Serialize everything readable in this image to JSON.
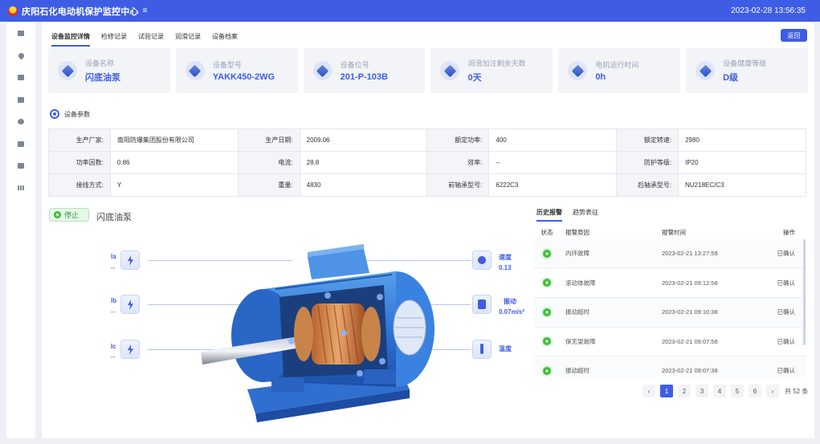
{
  "app": {
    "title": "庆阳石化电动机保护监控中心",
    "datetime": "2023-02-28 13:56:35"
  },
  "tabs": [
    "设备监控详情",
    "检修记录",
    "试验记录",
    "润滑记录",
    "设备档案"
  ],
  "back_label": "返回",
  "cards": [
    {
      "label": "设备名称",
      "value": "闪底油泵"
    },
    {
      "label": "设备型号",
      "value": "YAKK450-2WG"
    },
    {
      "label": "设备位号",
      "value": "201-P-103B"
    },
    {
      "label": "润滑加注剩余天数",
      "value": "0天"
    },
    {
      "label": "电机运行时间",
      "value": "0h"
    },
    {
      "label": "设备健康等级",
      "value": "D级"
    }
  ],
  "params_title": "设备参数",
  "params": [
    [
      {
        "k": "生产厂家:",
        "v": "南阳防爆集团股份有限公司"
      },
      {
        "k": "生产日期:",
        "v": "2009.06"
      },
      {
        "k": "额定功率:",
        "v": "400"
      },
      {
        "k": "额定转速:",
        "v": "2980"
      }
    ],
    [
      {
        "k": "功率因数:",
        "v": "0.86"
      },
      {
        "k": "电流:",
        "v": "28.8"
      },
      {
        "k": "效率:",
        "v": "--"
      },
      {
        "k": "防护等级:",
        "v": "IP20"
      }
    ],
    [
      {
        "k": "接线方式:",
        "v": "Y"
      },
      {
        "k": "重量:",
        "v": "4830"
      },
      {
        "k": "前轴承型号:",
        "v": "6222C3"
      },
      {
        "k": "后轴承型号:",
        "v": "NU218EC/C3"
      }
    ]
  ],
  "status": {
    "label": "停止",
    "equipment": "闪底油泵"
  },
  "sensors_left": [
    {
      "label": "Ia",
      "value": "--"
    },
    {
      "label": "Ib",
      "value": "--"
    },
    {
      "label": "Ic",
      "value": "--"
    }
  ],
  "sensors_right": [
    {
      "label": "速度",
      "value": "0.13"
    },
    {
      "label": "振动",
      "value": "0.07m/s²"
    },
    {
      "label": "温度",
      "value": ""
    }
  ],
  "alarm_tabs": [
    "历史报警",
    "趋势表征"
  ],
  "alarm_headers": [
    "状态",
    "报警原因",
    "报警时间",
    "操作"
  ],
  "alarms": [
    {
      "reason": "内环故障",
      "time": "2023-02-21 13:27:59",
      "action": "已确认"
    },
    {
      "reason": "滚动体故障",
      "time": "2023-02-21 09:12:58",
      "action": "已确认"
    },
    {
      "reason": "振动超时",
      "time": "2023-02-21 09:10:38",
      "action": "已确认"
    },
    {
      "reason": "保无架故障",
      "time": "2023-02-21 09:07:58",
      "action": "已确认"
    },
    {
      "reason": "振动超时",
      "time": "2023-02-21 09:07:38",
      "action": "已确认"
    }
  ],
  "pager": {
    "prev": "‹",
    "pages": [
      "1",
      "2",
      "3",
      "4",
      "5",
      "6"
    ],
    "next": "›",
    "total": "共 52 条"
  },
  "colors": {
    "primary": "#3f5de4",
    "success": "#3cbf3c"
  }
}
